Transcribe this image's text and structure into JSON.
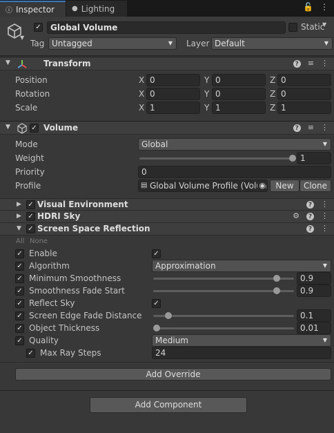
{
  "tabs": {
    "inspector": "Inspector",
    "lighting": "Lighting"
  },
  "object": {
    "name": "Global Volume",
    "static_label": "Static",
    "tag_label": "Tag",
    "tag_value": "Untagged",
    "layer_label": "Layer",
    "layer_value": "Default"
  },
  "transform": {
    "title": "Transform",
    "position_label": "Position",
    "rotation_label": "Rotation",
    "scale_label": "Scale",
    "x": "X",
    "y": "Y",
    "z": "Z",
    "position": [
      "0",
      "0",
      "0"
    ],
    "rotation": [
      "0",
      "0",
      "0"
    ],
    "scale": [
      "1",
      "1",
      "1"
    ]
  },
  "volume": {
    "title": "Volume",
    "mode_label": "Mode",
    "mode_value": "Global",
    "weight_label": "Weight",
    "weight_value": "1",
    "weight_fraction": 1,
    "priority_label": "Priority",
    "priority_value": "0",
    "profile_label": "Profile",
    "profile_value": "Global Volume Profile (Volun",
    "new_button": "New",
    "clone_button": "Clone"
  },
  "overrides": {
    "visual_environment": "Visual Environment",
    "hdri_sky": "HDRI Sky",
    "ssr": "Screen Space Reflection",
    "all": "All",
    "none": "None"
  },
  "ssr": {
    "enable_label": "Enable",
    "algorithm_label": "Algorithm",
    "algorithm_value": "Approximation",
    "min_smooth_label": "Minimum Smoothness",
    "min_smooth_value": "0.9",
    "smooth_fade_label": "Smoothness Fade Start",
    "smooth_fade_value": "0.9",
    "reflect_sky_label": "Reflect Sky",
    "edge_fade_label": "Screen Edge Fade Distance",
    "edge_fade_value": "0.1",
    "thickness_label": "Object Thickness",
    "thickness_value": "0.01",
    "quality_label": "Quality",
    "quality_value": "Medium",
    "max_ray_label": "Max Ray Steps",
    "max_ray_value": "24"
  },
  "buttons": {
    "add_override": "Add Override",
    "add_component": "Add Component"
  },
  "colors": {
    "accent": "#3a79bb",
    "panel": "#383838",
    "field": "#2a2a2a"
  }
}
